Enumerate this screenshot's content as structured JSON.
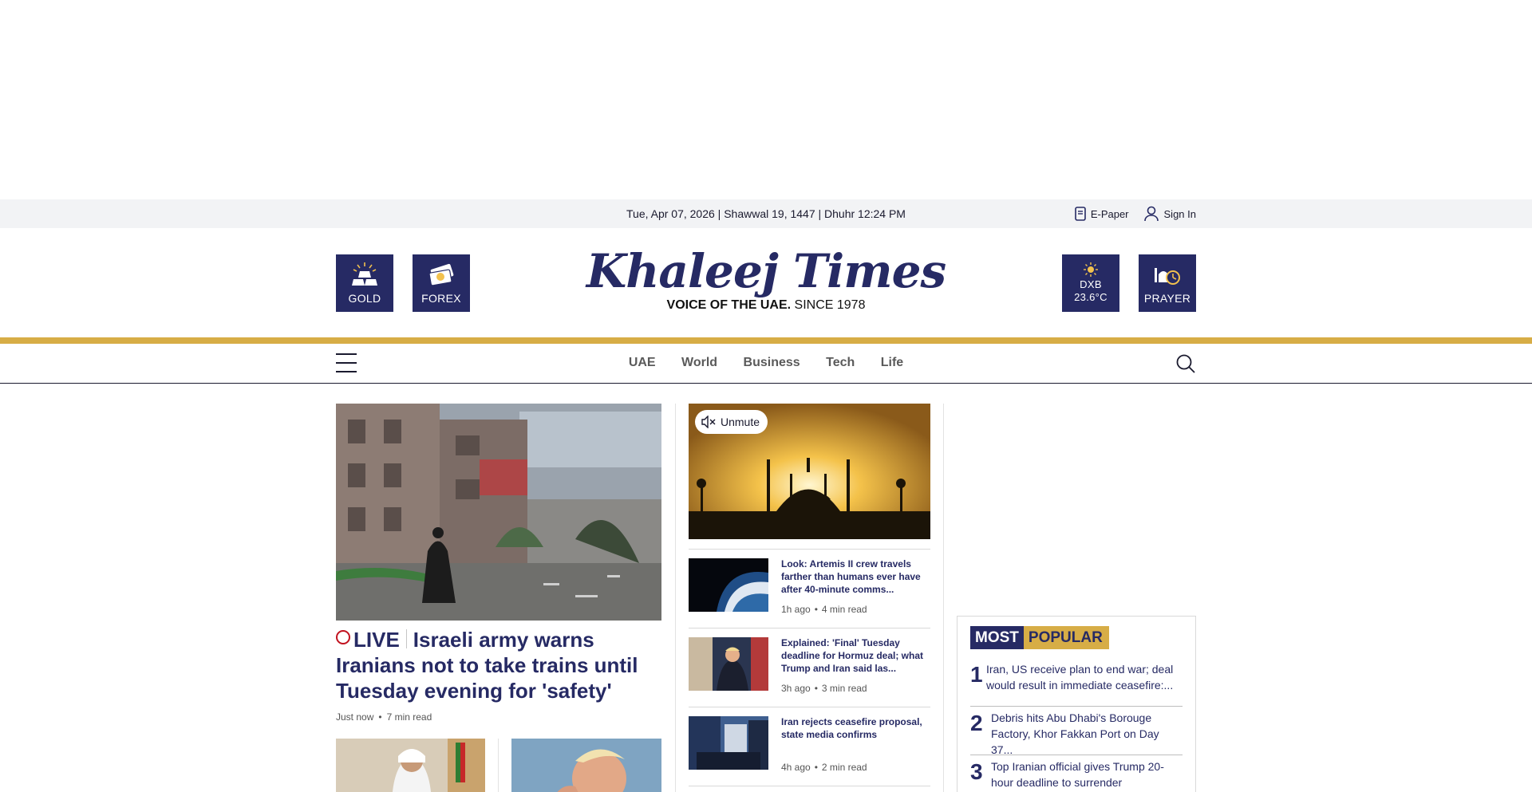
{
  "topbar": {
    "date": "Tue, Apr 07, 2026 | Shawwal 19, 1447 | Dhuhr 12:24 PM",
    "epaper": "E-Paper",
    "signin": "Sign In"
  },
  "masthead": {
    "logo": "Khaleej Times",
    "tagline_bold": "VOICE OF THE UAE.",
    "tagline_rest": " SINCE 1978",
    "gold": "GOLD",
    "forex": "FOREX",
    "weather_city": "DXB",
    "weather_temp": "23.6°C",
    "prayer": "PRAYER"
  },
  "nav": {
    "items": [
      "UAE",
      "World",
      "Business",
      "Tech",
      "Life"
    ]
  },
  "lead": {
    "live": "LIVE",
    "headline": "Israeli army warns Iranians not to take trains until Tuesday evening for 'safety'",
    "time": "Just now",
    "read": "7 min read"
  },
  "video": {
    "unmute": "Unmute"
  },
  "stories": [
    {
      "title": "Look: Artemis II crew travels farther than humans ever have after 40-minute comms...",
      "time": "1h ago",
      "read": "4 min read"
    },
    {
      "title": "Explained: 'Final' Tuesday deadline for Hormuz deal; what Trump and Iran said las...",
      "time": "3h ago",
      "read": "3 min read"
    },
    {
      "title": "Iran rejects ceasefire proposal, state media confirms",
      "time": "4h ago",
      "read": "2 min read"
    }
  ],
  "popular": {
    "head_a": "MOST",
    "head_b": "POPULAR",
    "items": [
      {
        "num": "1",
        "title": "Iran, US receive plan to end war; deal would result in immediate ceasefire:..."
      },
      {
        "num": "2",
        "title": "Debris hits Abu Dhabi's Borouge Factory, Khor Fakkan Port on Day 37..."
      },
      {
        "num": "3",
        "title": "Top Iranian official gives Trump 20-hour deadline to surrender"
      }
    ]
  },
  "colors": {
    "navy": "#262a64",
    "gold": "#d7ad46",
    "live_red": "#c1121f"
  }
}
